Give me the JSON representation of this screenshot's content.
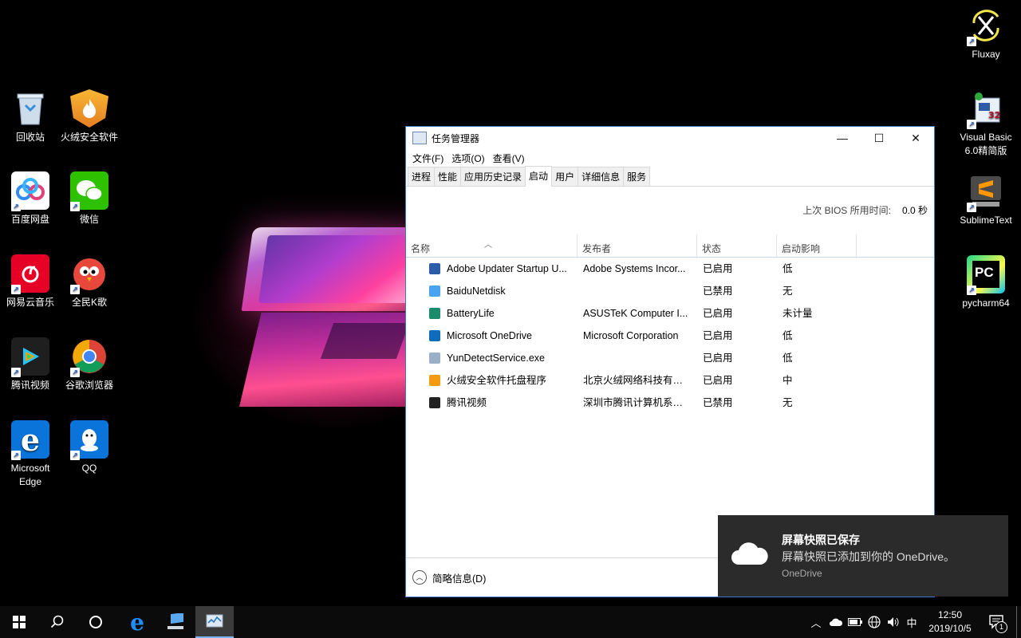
{
  "desktop": {
    "left_icons": [
      {
        "label": "回收站",
        "icon": "recycle-bin-icon",
        "color": "#d9e6f2"
      },
      {
        "label": "火绒安全软件",
        "icon": "huorong-icon",
        "color": "#f39c12"
      },
      {
        "label": "百度网盘",
        "icon": "baidu-netdisk-icon",
        "color": "#ffffff"
      },
      {
        "label": "微信",
        "icon": "wechat-icon",
        "color": "#2dc100"
      },
      {
        "label": "网易云音乐",
        "icon": "netease-music-icon",
        "color": "#e60026"
      },
      {
        "label": "全民K歌",
        "icon": "kge-icon",
        "color": "#ffffff"
      },
      {
        "label": "腾讯视频",
        "icon": "tencent-video-icon",
        "color": "#1f1f1f"
      },
      {
        "label": "谷歌浏览器",
        "icon": "chrome-icon",
        "color": "#ffffff"
      },
      {
        "label": "Microsoft Edge",
        "icon": "edge-icon",
        "color": "#0a74da"
      },
      {
        "label": "QQ",
        "icon": "qq-icon",
        "color": "#0a74da"
      }
    ],
    "right_icons": [
      {
        "label": "Fluxay",
        "icon": "fluxay-icon",
        "color": "#000000"
      },
      {
        "label": "Visual Basic 6.0精简版",
        "icon": "visual-basic-icon",
        "color": "#ffffff"
      },
      {
        "label": "SublimeText",
        "icon": "sublime-text-icon",
        "color": "#4a4a4a"
      },
      {
        "label": "pycharm64",
        "icon": "pycharm-icon",
        "color": "#21d789"
      }
    ]
  },
  "task_manager": {
    "title": "任务管理器",
    "window_buttons": {
      "minimize": "—",
      "maximize": "☐",
      "close": "✕"
    },
    "menu": [
      "文件(F)",
      "选项(O)",
      "查看(V)"
    ],
    "tabs": [
      "进程",
      "性能",
      "应用历史记录",
      "启动",
      "用户",
      "详细信息",
      "服务"
    ],
    "active_tab": "启动",
    "bios_label": "上次 BIOS 所用时间:",
    "bios_value": "0.0 秒",
    "columns": [
      "名称",
      "发布者",
      "状态",
      "启动影响"
    ],
    "rows": [
      {
        "name": "Adobe Updater Startup U...",
        "publisher": "Adobe Systems Incor...",
        "status": "已启用",
        "impact": "低",
        "icon": "adobe-updater-icon",
        "color": "#2a5caa"
      },
      {
        "name": "BaiduNetdisk",
        "publisher": "",
        "status": "已禁用",
        "impact": "无",
        "icon": "baidu-netdisk-icon",
        "color": "#4aa3f0"
      },
      {
        "name": "BatteryLife",
        "publisher": "ASUSTeK Computer I...",
        "status": "已启用",
        "impact": "未计量",
        "icon": "battery-life-icon",
        "color": "#1c8a6c"
      },
      {
        "name": "Microsoft OneDrive",
        "publisher": "Microsoft Corporation",
        "status": "已启用",
        "impact": "低",
        "icon": "onedrive-icon",
        "color": "#0f6cbd"
      },
      {
        "name": "YunDetectService.exe",
        "publisher": "",
        "status": "已启用",
        "impact": "低",
        "icon": "exe-file-icon",
        "color": "#9ab0c8"
      },
      {
        "name": "火绒安全软件托盘程序",
        "publisher": "北京火绒网络科技有限...",
        "status": "已启用",
        "impact": "中",
        "icon": "huorong-icon",
        "color": "#f39c12"
      },
      {
        "name": "腾讯视频",
        "publisher": "深圳市腾讯计算机系统...",
        "status": "已禁用",
        "impact": "无",
        "icon": "tencent-video-icon",
        "color": "#222222"
      }
    ],
    "footer_label": "简略信息(D)"
  },
  "toast": {
    "title": "屏幕快照已保存",
    "body": "屏幕快照已添加到你的 OneDrive。",
    "app": "OneDrive"
  },
  "taskbar": {
    "ime": "中",
    "time": "12:50",
    "date": "2019/10/5",
    "notification_count": "1"
  }
}
